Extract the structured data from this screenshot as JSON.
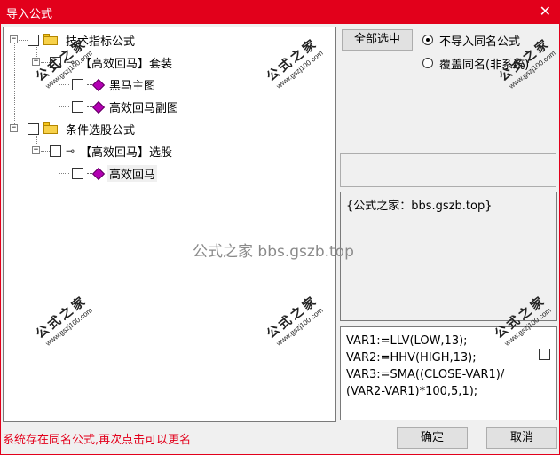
{
  "window": {
    "title": "导入公式"
  },
  "tree": {
    "nodes": [
      {
        "label": "技术指标公式"
      },
      {
        "label": "【高效回马】套装"
      },
      {
        "label": "黑马主图"
      },
      {
        "label": "高效回马副图"
      },
      {
        "label": "条件选股公式"
      },
      {
        "label": "【高效回马】选股"
      },
      {
        "label": "高效回马"
      }
    ],
    "expander_minus": "−"
  },
  "actions": {
    "select_all_label": "全部选中",
    "radio_no_import_label": "不导入同名公式",
    "radio_overwrite_label": "覆盖同名(非系统)",
    "radio_selected": "no_import"
  },
  "description": {
    "text": "{公式之家：bbs.gszb.top}"
  },
  "code": {
    "lines": [
      "VAR1:=LLV(LOW,13);",
      "VAR2:=HHV(HIGH,13);",
      "VAR3:=SMA((CLOSE-VAR1)/",
      "(VAR2-VAR1)*100,5,1);"
    ]
  },
  "status": {
    "message": "系统存在同名公式,再次点击可以更名"
  },
  "footer": {
    "ok_label": "确定",
    "cancel_label": "取消"
  },
  "watermarks": {
    "center": "公式之家 bbs.gszb.top",
    "stamp_big": "公式之家",
    "stamp_small": "www.gszj100.com"
  },
  "colors": {
    "accent": "#e2001b",
    "status_text": "#e2001b",
    "folder": "#f7d14a",
    "formula_icon": "#b300b3"
  }
}
